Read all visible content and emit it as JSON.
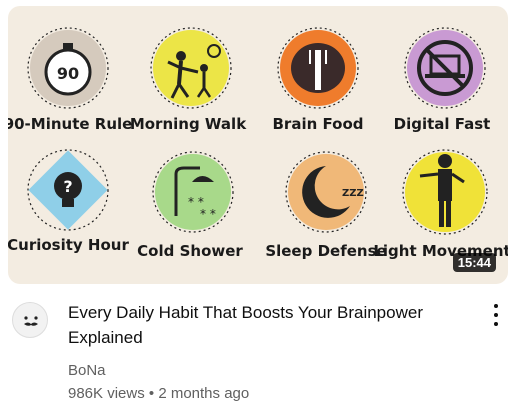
{
  "video": {
    "thumbnail": {
      "labels": [
        "90-Minute Rule",
        "Morning Walk",
        "Brain Food",
        "Digital Fast",
        "Curiosity Hour",
        "Cold Shower",
        "Sleep Defense",
        "Light Movement"
      ],
      "icons": [
        "stopwatch-90-icon",
        "walking-family-icon",
        "brain-fork-icon",
        "no-laptop-icon",
        "question-bulb-icon",
        "shower-icon",
        "sleeping-moon-icon",
        "person-stretch-icon"
      ],
      "colors": [
        "#b8a899",
        "#ece547",
        "#ef7c2c",
        "#c99ad3",
        "#8fcfe8",
        "#a8d98a",
        "#f0b878",
        "#f0e238"
      ],
      "stopwatch_text": "90",
      "sleep_text": "ZZZ"
    },
    "duration": "15:44",
    "title": "Every Daily Habit That Boosts Your Brainpower Explained",
    "channel": "BoNa",
    "views": "986K views",
    "separator": "•",
    "age": "2 months ago"
  }
}
